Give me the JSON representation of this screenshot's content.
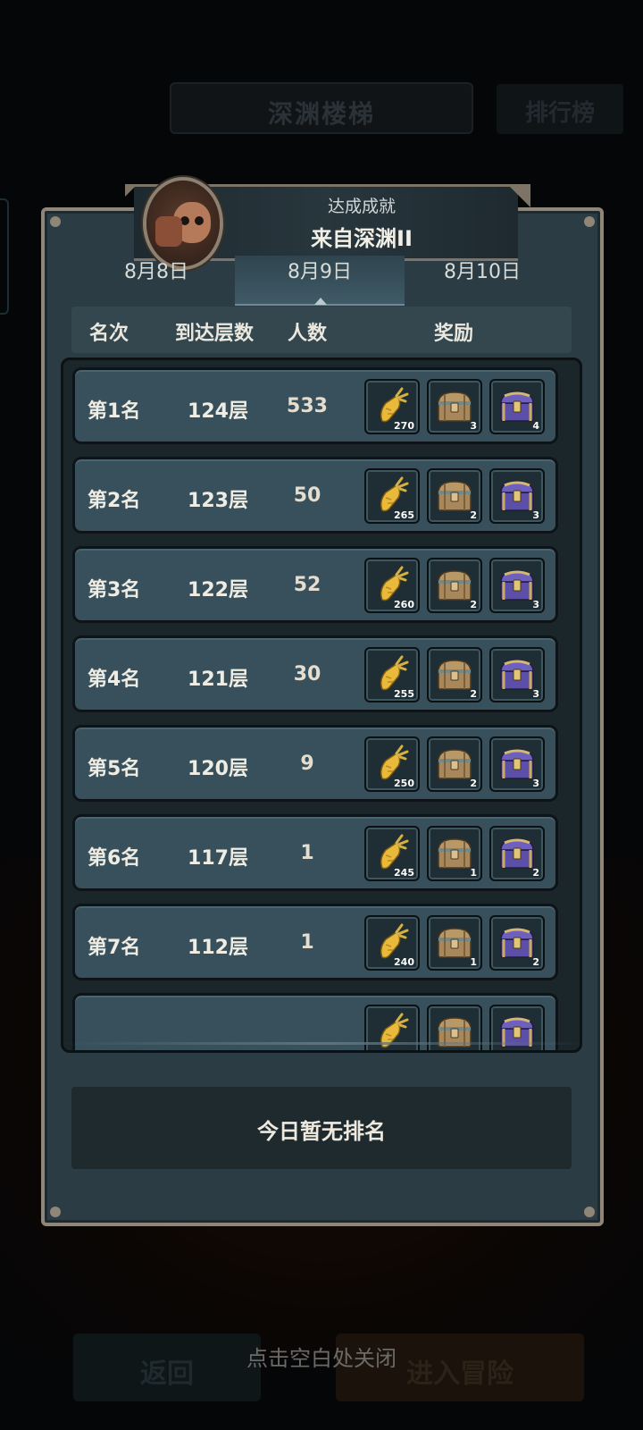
{
  "background": {
    "title": "深渊楼梯",
    "rank_button": "排行榜",
    "back_button": "返回",
    "enter_button": "进入冒险"
  },
  "achievement": {
    "label": "达成成就",
    "name": "来自深渊II"
  },
  "tabs": [
    {
      "label": "8月8日",
      "active": false
    },
    {
      "label": "8月9日",
      "active": true
    },
    {
      "label": "8月10日",
      "active": false
    }
  ],
  "columns": {
    "rank": "名次",
    "floor": "到达层数",
    "count": "人数",
    "reward": "奖励"
  },
  "rows": [
    {
      "rank": "第1名",
      "floor": "124层",
      "count": "533",
      "rewards": [
        "270",
        "3",
        "4"
      ]
    },
    {
      "rank": "第2名",
      "floor": "123层",
      "count": "50",
      "rewards": [
        "265",
        "2",
        "3"
      ]
    },
    {
      "rank": "第3名",
      "floor": "122层",
      "count": "52",
      "rewards": [
        "260",
        "2",
        "3"
      ]
    },
    {
      "rank": "第4名",
      "floor": "121层",
      "count": "30",
      "rewards": [
        "255",
        "2",
        "3"
      ]
    },
    {
      "rank": "第5名",
      "floor": "120层",
      "count": "9",
      "rewards": [
        "250",
        "2",
        "3"
      ]
    },
    {
      "rank": "第6名",
      "floor": "117层",
      "count": "1",
      "rewards": [
        "245",
        "1",
        "2"
      ]
    },
    {
      "rank": "第7名",
      "floor": "112层",
      "count": "1",
      "rewards": [
        "240",
        "1",
        "2"
      ]
    }
  ],
  "reward_icons": [
    "golden-carrot-icon",
    "bronze-chest-icon",
    "purple-chest-icon"
  ],
  "colors": {
    "panel": "#2c3c45",
    "row": "#37505b",
    "frame": "#8f8678",
    "carrot": "#e8b93a",
    "chest_bronze": "#a8875a",
    "chest_purple": "#5b4fa8"
  },
  "no_rank_text": "今日暂无排名",
  "close_hint": "点击空白处关闭"
}
